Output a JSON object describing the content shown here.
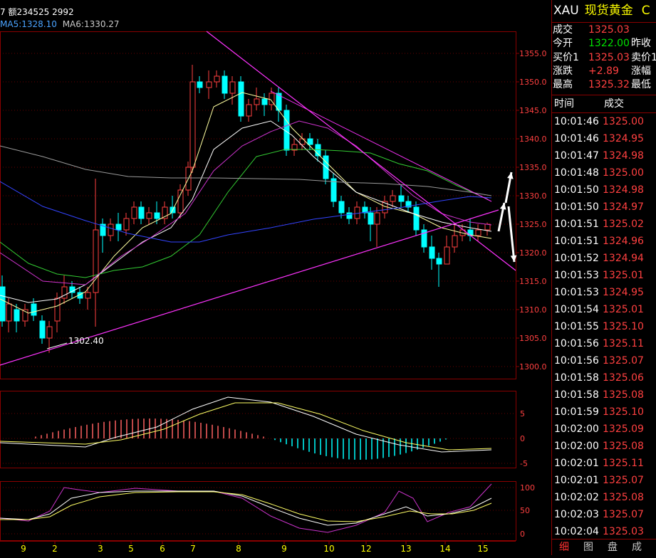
{
  "top": {
    "volume_text": "7 额234525 2992",
    "ma5": "MA5:1328.10",
    "ma6": "MA6:1330.27"
  },
  "y_axis_labels": [
    "1355.0",
    "1350.0",
    "1345.0",
    "1340.0",
    "1335.0",
    "1330.0",
    "1325.0",
    "1320.0",
    "1315.0",
    "1310.0",
    "1305.0",
    "1300.0"
  ],
  "macd_labels": [
    "5",
    "0",
    "-5"
  ],
  "kdj_labels": [
    "100",
    "50",
    "0"
  ],
  "x_axis_labels": [
    "9",
    "2",
    "3",
    "5",
    "6",
    "7",
    "8",
    "9",
    "10",
    "12",
    "13",
    "14",
    "15"
  ],
  "annotation_low": "1302.40",
  "colors": {
    "bg": "#000000",
    "grid_red": "#8a0000",
    "up": "#ff4040",
    "down": "#00ffff",
    "accent": "#ffff00"
  },
  "panel": {
    "symbol": "XAU",
    "name": "现货黄金",
    "tail": "C",
    "quotes": [
      {
        "label": "成交",
        "value": "1325.03",
        "right": ""
      },
      {
        "label": "今开",
        "value": "1322.00",
        "right": "昨收"
      },
      {
        "label": "买价1",
        "value": "1325.03",
        "right": "卖价1"
      },
      {
        "label": "涨跌",
        "value": "+2.89",
        "right": "涨幅"
      },
      {
        "label": "最高",
        "value": "1325.32",
        "right": "最低"
      }
    ],
    "tick_header": {
      "time": "时间",
      "price": "成交"
    },
    "ticks": [
      {
        "time": "10:01:46",
        "price": "1325.00"
      },
      {
        "time": "10:01:46",
        "price": "1324.95"
      },
      {
        "time": "10:01:47",
        "price": "1324.98"
      },
      {
        "time": "10:01:48",
        "price": "1325.00"
      },
      {
        "time": "10:01:50",
        "price": "1324.98"
      },
      {
        "time": "10:01:50",
        "price": "1324.97"
      },
      {
        "time": "10:01:51",
        "price": "1325.02"
      },
      {
        "time": "10:01:51",
        "price": "1324.96"
      },
      {
        "time": "10:01:52",
        "price": "1324.94"
      },
      {
        "time": "10:01:53",
        "price": "1325.01"
      },
      {
        "time": "10:01:53",
        "price": "1324.95"
      },
      {
        "time": "10:01:54",
        "price": "1325.01"
      },
      {
        "time": "10:01:55",
        "price": "1325.10"
      },
      {
        "time": "10:01:56",
        "price": "1325.11"
      },
      {
        "time": "10:01:56",
        "price": "1325.07"
      },
      {
        "time": "10:01:58",
        "price": "1325.06"
      },
      {
        "time": "10:01:58",
        "price": "1325.08"
      },
      {
        "time": "10:01:59",
        "price": "1325.10"
      },
      {
        "time": "10:02:00",
        "price": "1325.09"
      },
      {
        "time": "10:02:00",
        "price": "1325.08"
      },
      {
        "time": "10:02:01",
        "price": "1325.11"
      },
      {
        "time": "10:02:01",
        "price": "1325.07"
      },
      {
        "time": "10:02:02",
        "price": "1325.08"
      },
      {
        "time": "10:02:03",
        "price": "1325.07"
      },
      {
        "time": "10:02:04",
        "price": "1325.03"
      }
    ],
    "tabs": [
      "细",
      "图",
      "盘",
      "成"
    ]
  }
}
